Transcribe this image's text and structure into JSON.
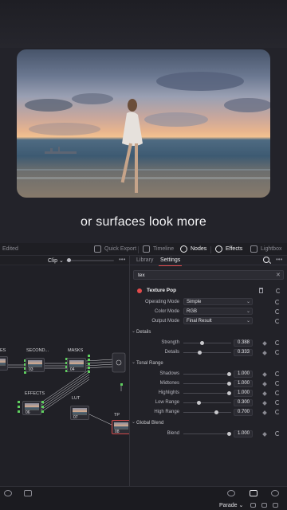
{
  "caption": "or surfaces look more",
  "topbar": {
    "edited": "Edited",
    "items": [
      {
        "label": "Quick Export",
        "icon": "export-icon"
      },
      {
        "label": "Timeline",
        "icon": "timeline-icon"
      },
      {
        "label": "Nodes",
        "icon": "nodes-icon"
      },
      {
        "label": "Effects",
        "icon": "effects-icon"
      },
      {
        "label": "Lightbox",
        "icon": "lightbox-icon"
      }
    ]
  },
  "node_editor": {
    "mode": "Clip",
    "nodes": [
      {
        "label": "ES",
        "num": ""
      },
      {
        "label": "SECOND...",
        "num": "03"
      },
      {
        "label": "MASKS",
        "num": "04"
      },
      {
        "label": "EFFECTS",
        "num": "06"
      },
      {
        "label": "LUT",
        "num": "07"
      },
      {
        "label": "TP",
        "num": "08"
      }
    ]
  },
  "panel": {
    "tabs": [
      "Library",
      "Settings"
    ],
    "search_value": "tex",
    "effect_name": "Texture Pop",
    "modes": [
      {
        "label": "Operating Mode",
        "value": "Simple"
      },
      {
        "label": "Color Mode",
        "value": "RGB"
      },
      {
        "label": "Output Mode",
        "value": "Final Result"
      }
    ],
    "details_title": "Details",
    "details": [
      {
        "label": "Strength",
        "value": "0.388",
        "level": 0.388
      },
      {
        "label": "Details",
        "value": "0.333",
        "level": 0.333
      }
    ],
    "tonal_title": "Tonal Range",
    "tonal": [
      {
        "label": "Shadows",
        "value": "1.000",
        "level": 1.0
      },
      {
        "label": "Midtones",
        "value": "1.000",
        "level": 1.0
      },
      {
        "label": "Highlights",
        "value": "1.000",
        "level": 1.0
      },
      {
        "label": "Low Range",
        "value": "0.300",
        "level": 0.3
      },
      {
        "label": "High Range",
        "value": "0.700",
        "level": 0.7
      }
    ],
    "global_title": "Global Blend",
    "global": [
      {
        "label": "Blend",
        "value": "1.000",
        "level": 1.0
      }
    ]
  },
  "bottombar": {
    "scope": "Parade"
  },
  "colors": {
    "accent_red": "#e24b4b",
    "background": "#1b1b20"
  }
}
